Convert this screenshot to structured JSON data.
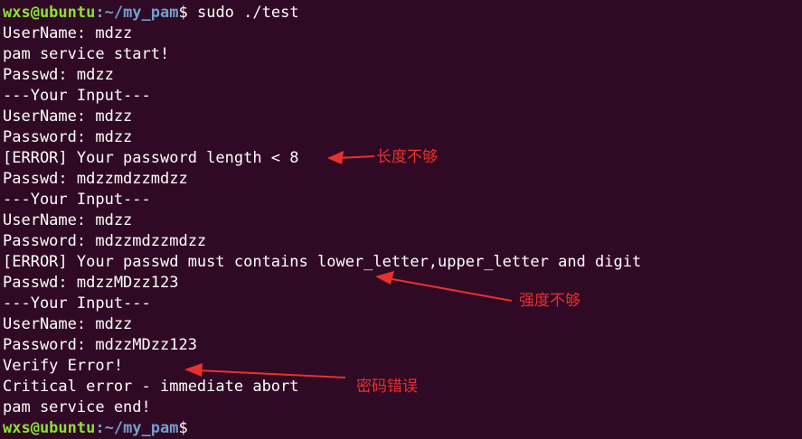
{
  "prompt": {
    "user_host": "wxs@ubuntu",
    "path": ":~/my_pam",
    "symbol": "$"
  },
  "command": " sudo ./test",
  "output_lines": [
    "UserName: mdzz",
    "pam service start!",
    "Passwd: mdzz",
    "---Your Input---",
    "UserName: mdzz",
    "Password: mdzz",
    "[ERROR] Your password length < 8",
    "Passwd: mdzzmdzzmdzz",
    "---Your Input---",
    "UserName: mdzz",
    "Password: mdzzmdzzmdzz",
    "[ERROR] Your passwd must contains lower_letter,upper_letter and digit",
    "Passwd: mdzzMDzz123",
    "---Your Input---",
    "UserName: mdzz",
    "Password: mdzzMDzz123",
    "Verify Error!",
    "Critical error - immediate abort",
    "pam service end!"
  ],
  "annotations": {
    "length": "长度不够",
    "strength": "强度不够",
    "password": "密码错误"
  },
  "colors": {
    "background": "#300a24",
    "prompt_user": "#8ae234",
    "prompt_path": "#729fcf",
    "annotation": "#e8312e"
  }
}
